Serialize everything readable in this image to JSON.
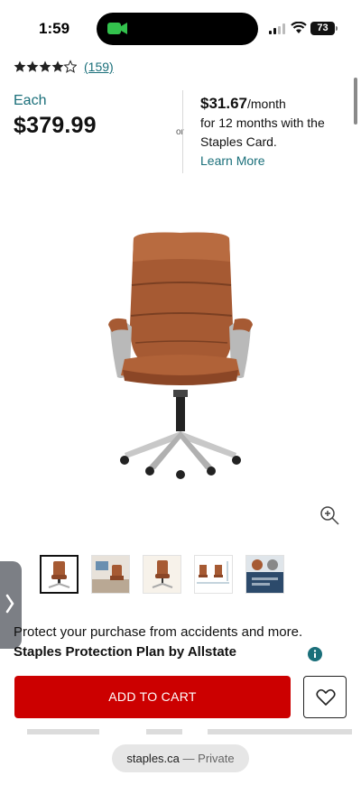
{
  "status_bar": {
    "time": "1:59",
    "battery": "73"
  },
  "rating": {
    "stars": 4.5,
    "review_count": "(159)"
  },
  "price": {
    "label": "Each",
    "value": "$379.99"
  },
  "financing": {
    "or_text": "or",
    "monthly_amount": "$31.67",
    "monthly_unit": "/month",
    "line1": "for 12 months with the",
    "line2": "Staples Card.",
    "learn_more": "Learn More"
  },
  "protection": {
    "text": "Protect your purchase from accidents and more.",
    "plan_name": "Staples Protection Plan by Allstate"
  },
  "cart": {
    "add_label": "ADD TO CART"
  },
  "browser": {
    "domain": "staples.ca",
    "separator": "—",
    "mode": "Private"
  },
  "colors": {
    "accent_teal": "#1a6f7a",
    "cart_red": "#cc0000",
    "leather": "#a65a33"
  },
  "icons": [
    "video-camera-icon",
    "signal-icon",
    "wifi-icon",
    "zoom-in-icon",
    "chevron-right-icon",
    "info-icon",
    "heart-icon"
  ]
}
